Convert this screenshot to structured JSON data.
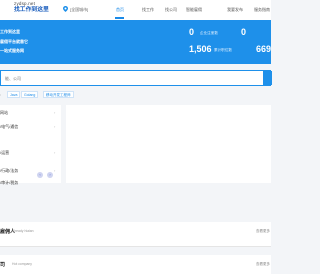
{
  "header": {
    "logo_top": "zydsp.net",
    "logo_main": "找工作到这里",
    "location": "[全国城市]",
    "nav": {
      "home": "首页",
      "find_work": "找工作",
      "find_company": "找公司",
      "hire": "智能雇佣",
      "release": "我要发布",
      "service": "服务指南"
    }
  },
  "banner": {
    "line1": "工作到这里",
    "line2": "雇佣平台就靠它",
    "line3": "一站式服务网",
    "stats": [
      {
        "number": "0",
        "label": "企业注册数"
      },
      {
        "number": "0",
        "label": ""
      },
      {
        "number": "1,506",
        "label": "累计职位数"
      },
      {
        "number": "669",
        "label": ""
      }
    ]
  },
  "search": {
    "placeholder": "能、公司"
  },
  "tags": {
    "prefix": ":",
    "items": [
      "Java",
      "Golang",
      "移动开发工程师"
    ]
  },
  "categories": [
    {
      "label": "网站"
    },
    {
      "label": "/电气/通信"
    },
    {
      "label": "/运营"
    },
    {
      "label": "/行政/法务"
    },
    {
      "label": "/审计/税务"
    }
  ],
  "sections": {
    "hire": {
      "title": "雇佣人",
      "subtitle": "Already hiaian",
      "more": "查看更多"
    },
    "company": {
      "title": "司",
      "subtitle": "Hot company",
      "more": "查看更多"
    }
  },
  "colors": {
    "brand": "#1e90ea",
    "nav_active": "#1a8ae8"
  }
}
